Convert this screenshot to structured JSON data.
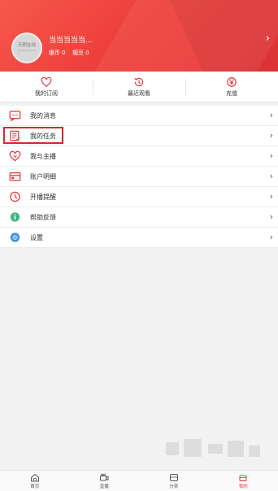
{
  "header": {
    "avatar_text": "天朗在线",
    "avatar_subtext": "Tianlang Online",
    "username": "当当当当当...",
    "coins_label": "银币",
    "coins_value": "0",
    "beans_label": "辐豆",
    "beans_value": "0",
    "arrow": "›"
  },
  "quick_actions": [
    {
      "label": "我的订阅",
      "icon": "heart-icon"
    },
    {
      "label": "最近观看",
      "icon": "clock-history-icon"
    },
    {
      "label": "充值",
      "icon": "yen-icon"
    }
  ],
  "menu": [
    {
      "label": "我的消息",
      "icon": "message-icon",
      "arrow": "›"
    },
    {
      "label": "我的任务",
      "icon": "task-list-icon",
      "arrow": "›",
      "highlighted": true
    },
    {
      "label": "我与主播",
      "icon": "heart-swap-icon",
      "arrow": "›"
    },
    {
      "label": "账户明细",
      "icon": "account-detail-icon",
      "arrow": "›"
    },
    {
      "label": "开播提醒",
      "icon": "alarm-clock-icon",
      "arrow": "›"
    },
    {
      "label": "帮助反馈",
      "icon": "help-icon",
      "arrow": "›"
    },
    {
      "label": "设置",
      "icon": "settings-icon",
      "arrow": "›"
    }
  ],
  "tabbar": [
    {
      "label": "首页",
      "icon": "home-icon"
    },
    {
      "label": "直播",
      "icon": "live-camera-icon"
    },
    {
      "label": "分类",
      "icon": "category-icon"
    },
    {
      "label": "我的",
      "icon": "profile-icon",
      "active": true
    }
  ],
  "colors": {
    "brand_red": "#e8363a",
    "highlight_border": "#d9252c",
    "help_green": "#3bb77e",
    "settings_blue": "#3a8ee6"
  }
}
